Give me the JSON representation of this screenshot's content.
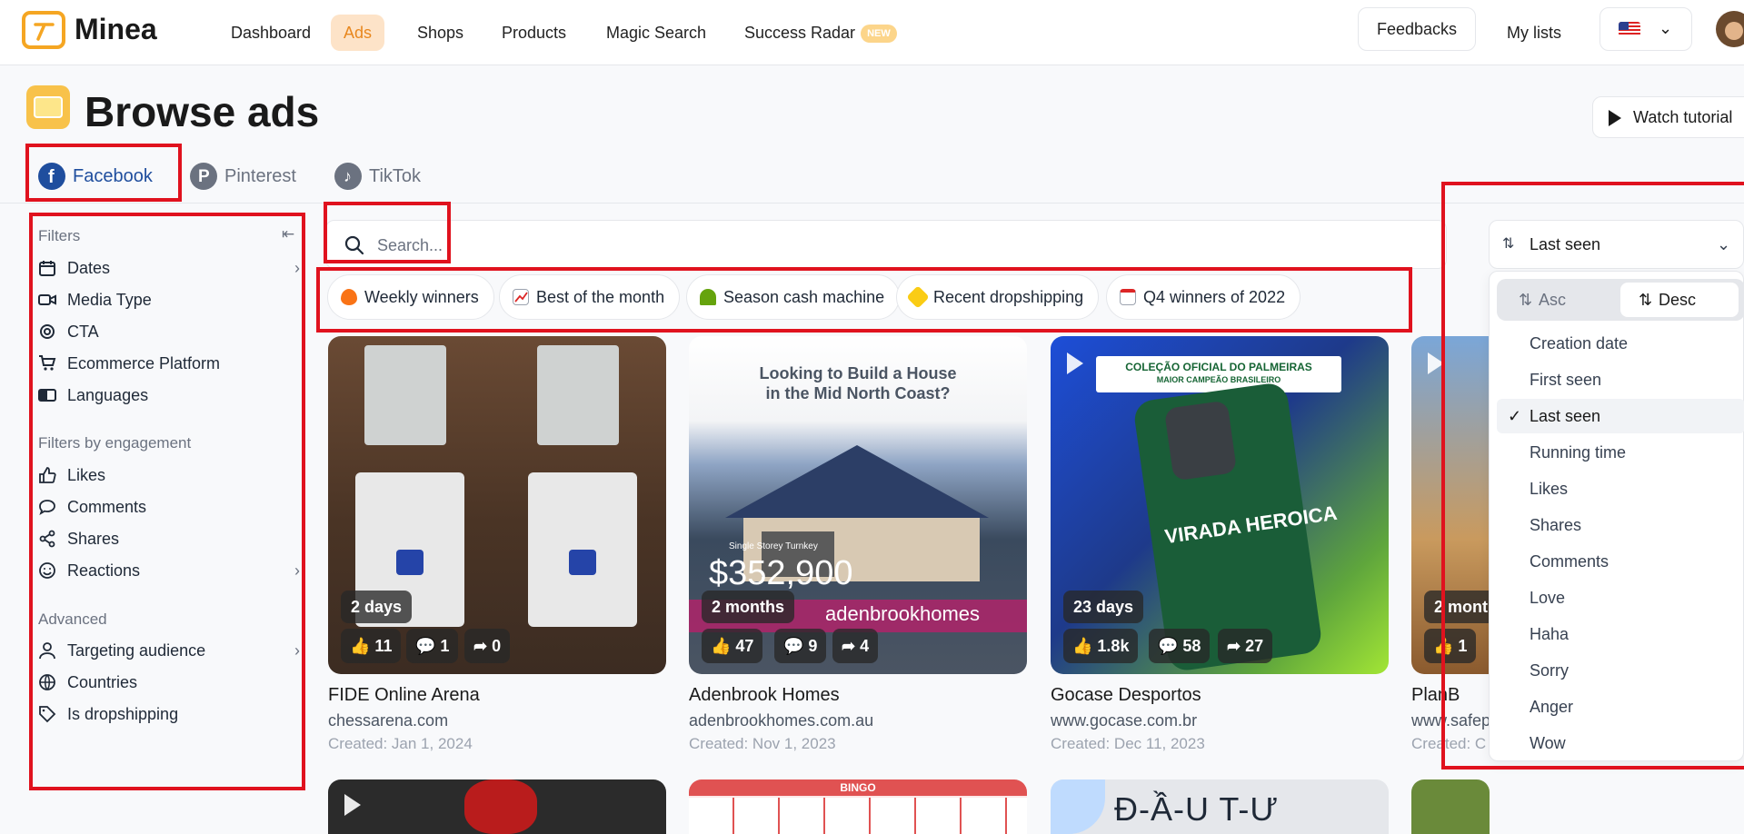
{
  "brand": {
    "name": "Minea",
    "accent": "#f5a623"
  },
  "nav": {
    "items": [
      "Dashboard",
      "Ads",
      "Shops",
      "Products",
      "Magic Search",
      "Success Radar"
    ],
    "new_badge": "NEW",
    "active": "Ads",
    "feedbacks": "Feedbacks",
    "my_lists": "My lists",
    "language": "US flag"
  },
  "page": {
    "title": "Browse ads",
    "watch_tutorial": "Watch tutorial"
  },
  "platforms": {
    "tabs": [
      "Facebook",
      "Pinterest",
      "TikTok"
    ],
    "active": "Facebook"
  },
  "filters": {
    "heading": "Filters",
    "items": [
      "Dates",
      "Media Type",
      "CTA",
      "Ecommerce Platform",
      "Languages"
    ],
    "engagement_heading": "Filters by engagement",
    "engagement_items": [
      "Likes",
      "Comments",
      "Shares",
      "Reactions"
    ],
    "advanced_heading": "Advanced",
    "advanced_items": [
      "Targeting audience",
      "Countries",
      "Is dropshipping"
    ]
  },
  "search": {
    "placeholder": "Search..."
  },
  "chips": [
    "Weekly winners",
    "Best of the month",
    "Season cash machine",
    "Recent dropshipping",
    "Q4 winners of 2022"
  ],
  "cards": [
    {
      "age": "2 days",
      "likes": "11",
      "comments": "1",
      "shares": "0",
      "title": "FIDE Online Arena",
      "url": "chessarena.com",
      "created": "Created: Jan 1, 2024",
      "overlay": ""
    },
    {
      "age": "2 months",
      "likes": "47",
      "comments": "9",
      "shares": "4",
      "title": "Adenbrook Homes",
      "url": "adenbrookhomes.com.au",
      "created": "Created: Nov 1, 2023",
      "overlay": "Looking to Build a House in the Mid North Coast?",
      "price": "$352,900",
      "price_label": "Single Storey Turnkey",
      "brand_text": "adenbrookhomes"
    },
    {
      "age": "23 days",
      "likes": "1.8k",
      "comments": "58",
      "shares": "27",
      "title": "Gocase Desportos",
      "url": "www.gocase.com.br",
      "created": "Created: Dec 11, 2023",
      "overlay": "COLEÇÃO OFICIAL DO PALMEIRAS",
      "overlay2": "MAIOR CAMPEÃO BRASILEIRO",
      "case_text": "VIRADA HEROICA"
    },
    {
      "age": "2 mont",
      "likes": "1",
      "comments": "",
      "shares": "",
      "title": "PlanB",
      "url": "www.safep",
      "created": "Created: C",
      "overlay": ""
    }
  ],
  "bottom_row": {
    "bingo": "BINGO",
    "dautu": "Đ-Ầ-U T-Ư"
  },
  "sort": {
    "selected": "Last seen",
    "asc": "Asc",
    "desc": "Desc",
    "direction": "Desc",
    "options": [
      "Creation date",
      "First seen",
      "Last seen",
      "Running time",
      "Likes",
      "Shares",
      "Comments",
      "Love",
      "Haha",
      "Sorry",
      "Anger",
      "Wow"
    ]
  }
}
